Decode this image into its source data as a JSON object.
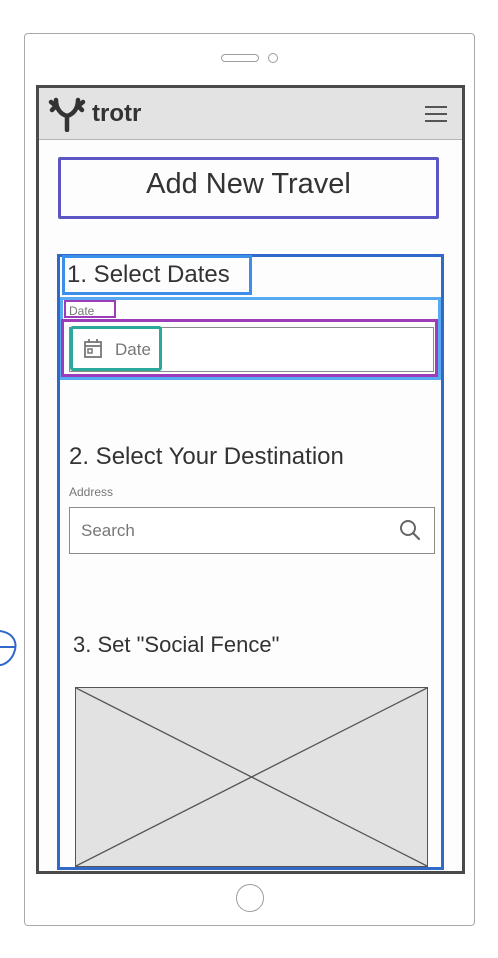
{
  "colors": {
    "title_box": "#5b55c6",
    "outer_box": "#3069c9",
    "section_box": "#3b8fe8",
    "field_block": "#57a9f2",
    "purple_highlight": "#9b3cb8",
    "teal_highlight": "#2aa89a",
    "appbar": "#e3e3e3"
  },
  "app": {
    "brand": "trotr",
    "logo_icon": "antler-logo-icon",
    "menu_icon": "hamburger-menu-icon"
  },
  "page": {
    "title": "Add New Travel"
  },
  "section1": {
    "heading": "1. Select Dates",
    "date_label": "Date",
    "date_placeholder": "Date",
    "date_icon": "calendar-icon"
  },
  "section2": {
    "heading": "2. Select Your Destination",
    "address_label": "Address",
    "search_placeholder": "Search",
    "search_icon": "search-icon"
  },
  "section3": {
    "heading": "3. Set \"Social Fence\"",
    "map_placeholder": "image-placeholder"
  }
}
